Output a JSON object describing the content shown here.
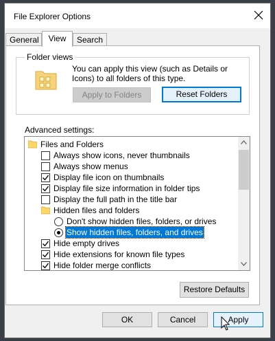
{
  "window": {
    "title": "File Explorer Options"
  },
  "tabs": [
    {
      "label": "General"
    },
    {
      "label": "View"
    },
    {
      "label": "Search"
    }
  ],
  "folder_views": {
    "group_title": "Folder views",
    "description": "You can apply this view (such as Details or Icons) to all folders of this type.",
    "apply_button": "Apply to Folders",
    "reset_button": "Reset Folders"
  },
  "advanced": {
    "label": "Advanced settings:",
    "items": [
      {
        "kind": "folder",
        "label": "Files and Folders",
        "level": 0
      },
      {
        "kind": "checkbox",
        "label": "Always show icons, never thumbnails",
        "checked": false,
        "level": 1
      },
      {
        "kind": "checkbox",
        "label": "Always show menus",
        "checked": false,
        "level": 1
      },
      {
        "kind": "checkbox",
        "label": "Display file icon on thumbnails",
        "checked": true,
        "level": 1
      },
      {
        "kind": "checkbox",
        "label": "Display file size information in folder tips",
        "checked": true,
        "level": 1
      },
      {
        "kind": "checkbox",
        "label": "Display the full path in the title bar",
        "checked": false,
        "level": 1
      },
      {
        "kind": "folder",
        "label": "Hidden files and folders",
        "level": 1
      },
      {
        "kind": "radio",
        "label": "Don't show hidden files, folders, or drives",
        "checked": false,
        "level": 2
      },
      {
        "kind": "radio",
        "label": "Show hidden files, folders, and drives",
        "checked": true,
        "level": 2,
        "selected": true
      },
      {
        "kind": "checkbox",
        "label": "Hide empty drives",
        "checked": true,
        "level": 1
      },
      {
        "kind": "checkbox",
        "label": "Hide extensions for known file types",
        "checked": true,
        "level": 1
      },
      {
        "kind": "checkbox",
        "label": "Hide folder merge conflicts",
        "checked": true,
        "level": 1
      }
    ]
  },
  "restore_button": "Restore Defaults",
  "footer": {
    "ok": "OK",
    "cancel": "Cancel",
    "apply": "Apply"
  },
  "colors": {
    "accent": "#0078d7",
    "folder": "#ffd766"
  }
}
